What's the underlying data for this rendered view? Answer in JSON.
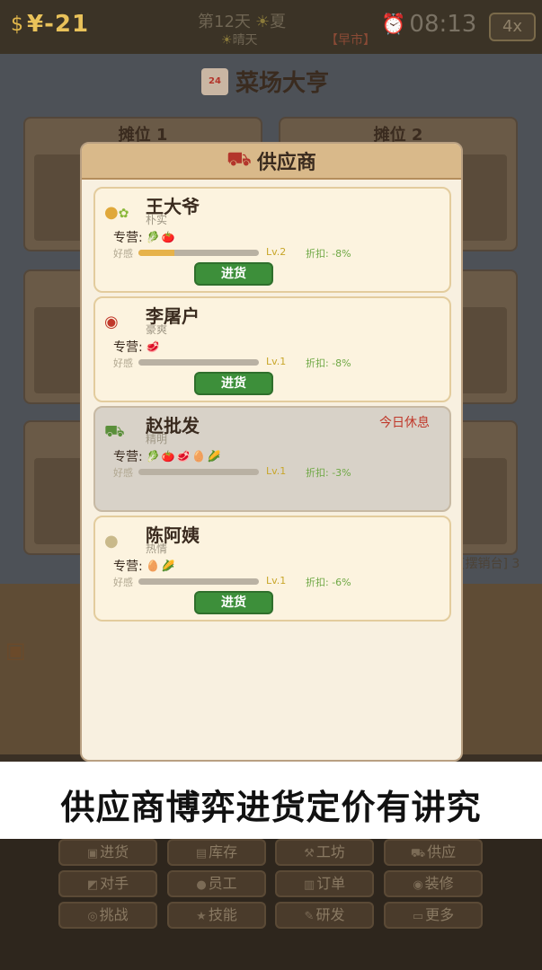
{
  "topbar": {
    "money": "¥-21",
    "day": "第12天",
    "season": "夏",
    "weather": "晴天",
    "market": "【早市】",
    "time": "08:13",
    "speed": "4x"
  },
  "shop": {
    "title": "菜场大亨",
    "logo_text": "24",
    "stalls": [
      "摊位 1",
      "摊位 2"
    ],
    "ghost_text": "[摆销台] 3"
  },
  "modal": {
    "title": "供应商",
    "specialty_label": "专营:",
    "favor_label": "好感",
    "buy_label": "进货",
    "suppliers": [
      {
        "name": "王大爷",
        "trait": "朴实",
        "avatar_icon": "elder-man-icon",
        "goods": "🥬🍅",
        "level": "Lv.2",
        "discount": "折扣: -8%",
        "favor": 0.3,
        "status": "",
        "can_buy": true
      },
      {
        "name": "李屠户",
        "trait": "豪爽",
        "avatar_icon": "meat-icon",
        "goods": "🥩",
        "level": "Lv.1",
        "discount": "折扣: -8%",
        "favor": 0.0,
        "status": "",
        "can_buy": true
      },
      {
        "name": "赵批发",
        "trait": "精明",
        "avatar_icon": "truck-icon",
        "goods": "🥬🍅🥩🥚🌽",
        "level": "Lv.1",
        "discount": "折扣: -3%",
        "favor": 0.0,
        "status": "今日休息",
        "can_buy": false
      },
      {
        "name": "陈阿姨",
        "trait": "热情",
        "avatar_icon": "grandma-icon",
        "goods": "🥚🌽",
        "level": "Lv.1",
        "discount": "折扣: -6%",
        "favor": 0.0,
        "status": "",
        "can_buy": true
      }
    ]
  },
  "caption": "供应商博弈进货定价有讲究",
  "menu": {
    "items": [
      {
        "label": "进货",
        "icon": "crate-icon",
        "glyph": "▣"
      },
      {
        "label": "库存",
        "icon": "clipboard-icon",
        "glyph": "▤"
      },
      {
        "label": "工坊",
        "icon": "hammer-icon",
        "glyph": "⚒"
      },
      {
        "label": "供应",
        "icon": "truck-icon",
        "glyph": "⛟"
      },
      {
        "label": "对手",
        "icon": "rival-icon",
        "glyph": "◩"
      },
      {
        "label": "员工",
        "icon": "person-icon",
        "glyph": "●"
      },
      {
        "label": "订单",
        "icon": "order-icon",
        "glyph": "▥"
      },
      {
        "label": "装修",
        "icon": "palette-icon",
        "glyph": "◉"
      },
      {
        "label": "挑战",
        "icon": "target-icon",
        "glyph": "◎"
      },
      {
        "label": "技能",
        "icon": "star-icon",
        "glyph": "★"
      },
      {
        "label": "研发",
        "icon": "pencil-icon",
        "glyph": "✎"
      },
      {
        "label": "更多",
        "icon": "book-icon",
        "glyph": "▭"
      }
    ]
  }
}
